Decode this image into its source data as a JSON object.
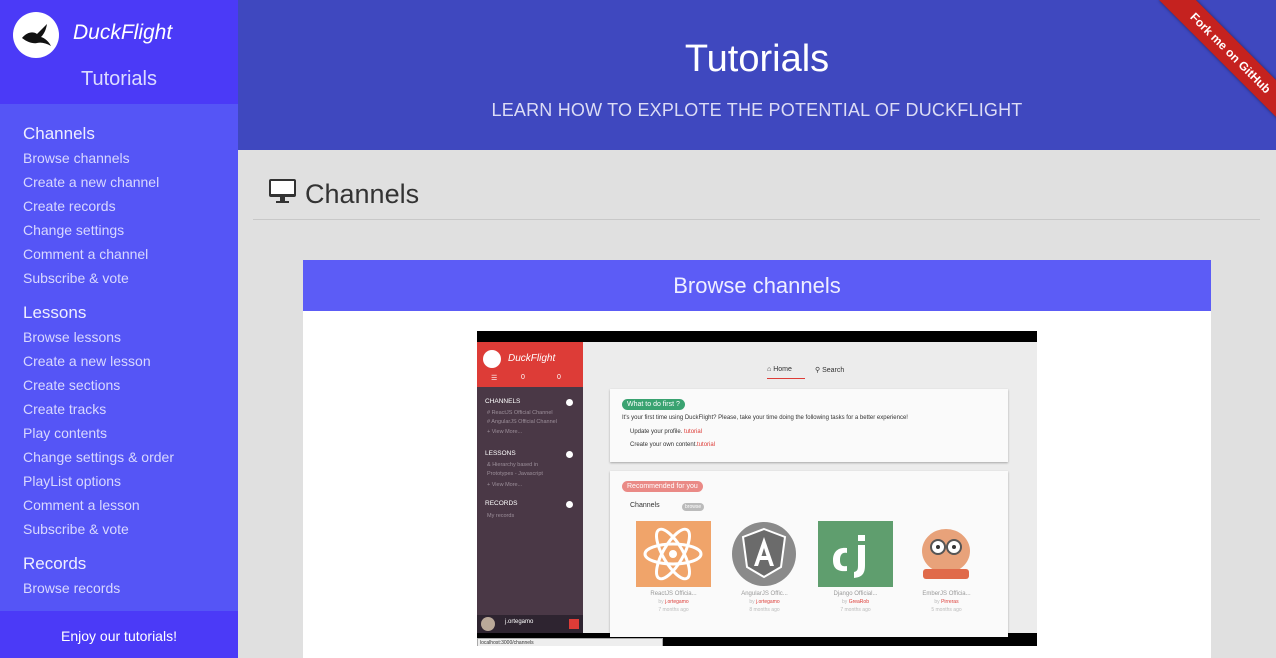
{
  "sidebar": {
    "brand": "DuckFlight",
    "subtitle": "Tutorials",
    "sections": [
      {
        "title": "Channels",
        "items": [
          "Browse channels",
          "Create a new channel",
          "Create records",
          "Change settings",
          "Comment a channel",
          "Subscribe & vote"
        ]
      },
      {
        "title": "Lessons",
        "items": [
          "Browse lessons",
          "Create a new lesson",
          "Create sections",
          "Create tracks",
          "Play contents",
          "Change settings & order",
          "PlayList options",
          "Comment a lesson",
          "Subscribe & vote"
        ]
      },
      {
        "title": "Records",
        "items": [
          "Browse records"
        ]
      }
    ],
    "footer": "Enjoy our tutorials!"
  },
  "header": {
    "title": "Tutorials",
    "subtitle": "LEARN HOW TO EXPLOTE THE POTENTIAL OF DUCKFLIGHT",
    "ribbon": "Fork me on GitHub"
  },
  "main": {
    "section_title": "Channels",
    "section_icon": "monitor-icon",
    "card_title": "Browse channels"
  },
  "video": {
    "app_name": "DuckFlight",
    "badge1": "0",
    "badge2": "0",
    "nav_home": "Home",
    "nav_search": "Search",
    "side_channels": "CHANNELS",
    "side_channel_items": [
      "# ReactJS Official Channel",
      "# AngularJS Official Channel",
      "+ View More..."
    ],
    "side_lessons": "LESSONS",
    "side_lesson_items": [
      "& Hierarchy based in",
      "Prototypes - Javascript",
      "+ View More..."
    ],
    "side_records": "RECORDS",
    "side_record_items": [
      "My records"
    ],
    "user": "j.ortegamo",
    "url": "localhost:3000/channels",
    "what_to_do": "What to do first ?",
    "intro": "It's your first time using DuckFlight? Please, take your time doing the following tasks for a better experience!",
    "task1": "Update your profile.",
    "task2": "Create your own content.",
    "task_tag": "tutorial",
    "recommended": "Recommended for you",
    "channels_label": "Channels",
    "browse_label": "browse",
    "tiles": [
      {
        "name": "ReactJS Officia...",
        "by_prefix": "by",
        "by": "j.ortegamo",
        "meta": "7 months ago",
        "color": "#f0a46a"
      },
      {
        "name": "AngularJS Offic...",
        "by_prefix": "by",
        "by": "j.ortegamo",
        "meta": "8 months ago",
        "color": "#8a8a8a"
      },
      {
        "name": "Django Official...",
        "by_prefix": "by",
        "by": "GreaRob",
        "meta": "7 months ago",
        "color": "#5f9e6e"
      },
      {
        "name": "EmberJS Officia...",
        "by_prefix": "by",
        "by": "Pirreras",
        "meta": "5 months ago",
        "color": "#e8d4c8"
      }
    ]
  }
}
